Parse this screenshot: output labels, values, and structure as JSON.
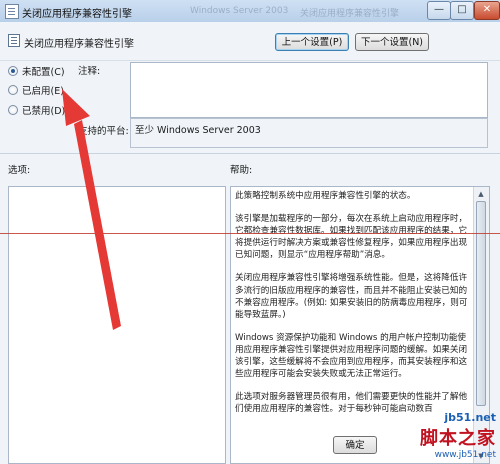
{
  "window": {
    "title": "关闭应用程序兼容性引擎",
    "ghost_text_left": "Windows Server 2003",
    "ghost_text_right": "关闭应用程序兼容性引擎",
    "minimize_glyph": "—",
    "maximize_glyph": "□",
    "close_glyph": "✕"
  },
  "header": {
    "policy_name": "关闭应用程序兼容性引擎",
    "prev_button": "上一个设置(P)",
    "next_button": "下一个设置(N)"
  },
  "state": {
    "options": [
      {
        "label": "未配置(C)",
        "checked": true
      },
      {
        "label": "已启用(E)",
        "checked": false
      },
      {
        "label": "已禁用(D)",
        "checked": false
      }
    ],
    "comment_label": "注释:",
    "platform_label": "支持的平台:",
    "platform_value": "至少 Windows Server 2003"
  },
  "sections": {
    "options_label": "选项:",
    "help_label": "帮助:"
  },
  "help": {
    "paragraphs": [
      "此策略控制系统中应用程序兼容性引擎的状态。",
      "该引擎是加载程序的一部分，每次在系统上启动应用程序时，它都检查兼容性数据库。如果找到匹配该应用程序的结果，它将提供运行时解决方案或兼容性修复程序，如果应用程序出现已知问题，则显示“应用程序帮助”消息。",
      "关闭应用程序兼容性引擎将增强系统性能。但是，这将降低许多流行的旧版应用程序的兼容性，而且并不能阻止安装已知的不兼容应用程序。(例如: 如果安装旧的防病毒应用程序，则可能导致蓝屏。)",
      "Windows 资源保护功能和 Windows 的用户帐户控制功能使用应用程序兼容性引擎提供对应用程序问题的缓解。如果关闭该引擎，这些缓解将不会应用到应用程序，而其安装程序和这些应用程序可能会安装失败或无法正常运行。",
      "此选项对服务器管理员很有用，他们需要更快的性能并了解他们使用应用程序的兼容性。对于每秒钟可能启动数百"
    ]
  },
  "footer": {
    "ok_button": "确定"
  },
  "watermark": {
    "site": "jb51.net",
    "name": "脚本之家",
    "url": "www.jb51.net"
  },
  "colors": {
    "accent": "#e53935",
    "annotation_line": "#c0392b"
  },
  "icons": [
    "policy-document-icon",
    "red-annotation-arrow-icon",
    "scroll-up-icon",
    "scroll-down-icon"
  ]
}
